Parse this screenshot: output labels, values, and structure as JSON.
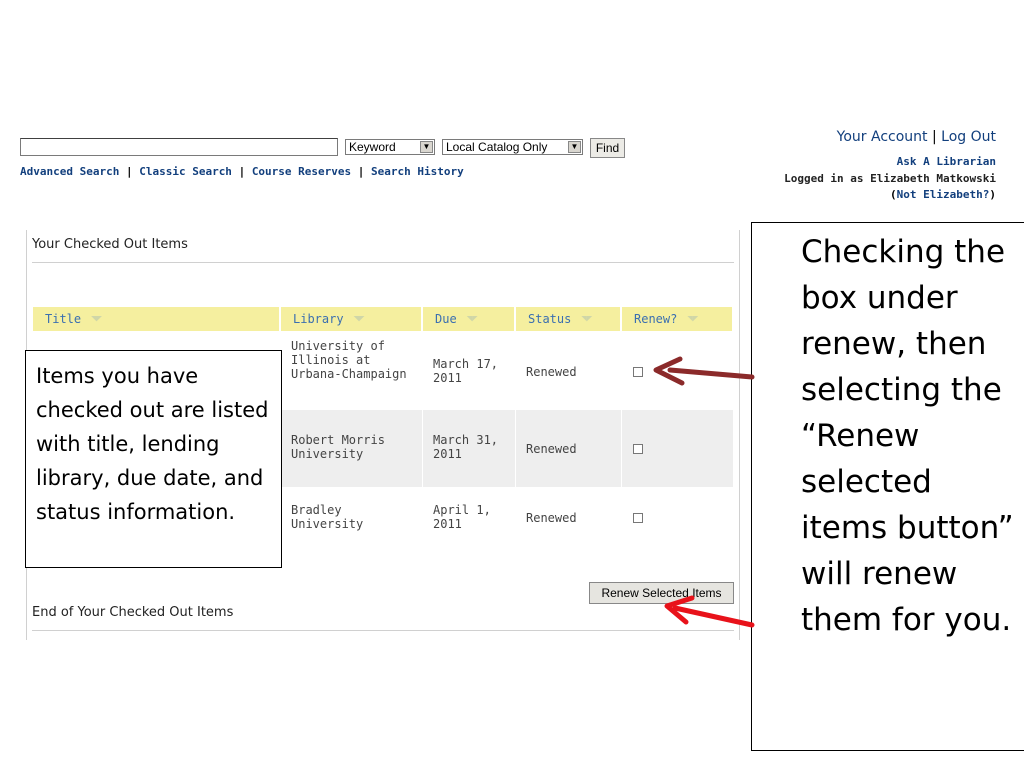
{
  "search": {
    "type_value": "Keyword",
    "scope_value": "Local Catalog Only",
    "find_label": "Find"
  },
  "nav_links": [
    "Advanced Search",
    "Classic Search",
    "Course Reserves",
    "Search History"
  ],
  "account": {
    "your_account": "Your Account",
    "log_out": "Log Out",
    "ask_librarian": "Ask A Librarian",
    "logged_in_as": "Logged in as Elizabeth Matkowski",
    "not_user": "Not Elizabeth?"
  },
  "panel": {
    "title": "Your Checked Out Items",
    "footer": "End of Your Checked Out Items",
    "renew_button": "Renew Selected Items",
    "columns": [
      "Title",
      "Library",
      "Due",
      "Status",
      "Renew?"
    ],
    "rows": [
      {
        "library": "University of Illinois at Urbana-Champaign",
        "due": "March 17, 2011",
        "status": "Renewed"
      },
      {
        "library": "Robert Morris University",
        "due": "March 31, 2011",
        "status": "Renewed"
      },
      {
        "library": "Bradley University",
        "due": "April 1, 2011",
        "status": "Renewed"
      }
    ]
  },
  "callouts": {
    "left": "Items you have checked out are listed with title, lending library, due date, and status information.",
    "right": "Checking the box under renew, then selecting the “Renew selected items button” will renew them for you."
  },
  "colors": {
    "link": "#123f7d",
    "header_bg": "#f5ef9f",
    "header_text": "#3b6fb0",
    "arrow_dark": "#8b2a2a",
    "arrow_red": "#e8121a"
  }
}
